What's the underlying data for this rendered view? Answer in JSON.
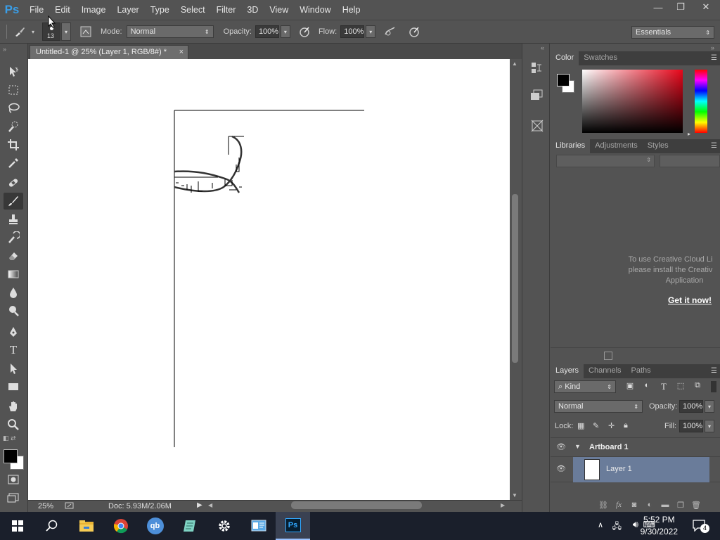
{
  "app": {
    "logo": "Ps"
  },
  "menu": [
    "File",
    "Edit",
    "Image",
    "Layer",
    "Type",
    "Select",
    "Filter",
    "3D",
    "View",
    "Window",
    "Help"
  ],
  "window_controls": {
    "minimize": "—",
    "restore": "❐",
    "close": "✕"
  },
  "options_bar": {
    "brush_size": "13",
    "mode_label": "Mode:",
    "mode_value": "Normal",
    "opacity_label": "Opacity:",
    "opacity_value": "100%",
    "flow_label": "Flow:",
    "flow_value": "100%",
    "workspace": "Essentials"
  },
  "document": {
    "tab_title": "Untitled-1 @ 25% (Layer 1, RGB/8#) *",
    "tab_close": "×",
    "zoom": "25%",
    "doc_info": "Doc: 5.93M/2.06M"
  },
  "color_panel": {
    "tabs": [
      "Color",
      "Swatches"
    ],
    "foreground": "#000000",
    "background": "#ffffff"
  },
  "libraries_panel": {
    "tabs": [
      "Libraries",
      "Adjustments",
      "Styles"
    ],
    "message_lines": [
      "To use Creative Cloud Li",
      "please install the Creativ",
      "Application"
    ],
    "link": "Get it now!"
  },
  "layers_panel": {
    "tabs": [
      "Layers",
      "Channels",
      "Paths"
    ],
    "filter_kind": "Kind",
    "blend_mode": "Normal",
    "opacity_label": "Opacity:",
    "opacity_value": "100%",
    "lock_label": "Lock:",
    "fill_label": "Fill:",
    "fill_value": "100%",
    "layers": [
      {
        "name": "Artboard 1",
        "type": "artboard"
      },
      {
        "name": "Layer 1",
        "type": "pixel",
        "selected": true
      }
    ]
  },
  "taskbar": {
    "time": "5:52 PM",
    "date": "9/30/2022",
    "notifications": "4"
  },
  "colors": {
    "accent": "#3a9ee8",
    "selected_layer": "#6a7c9a",
    "panel": "#535353"
  }
}
